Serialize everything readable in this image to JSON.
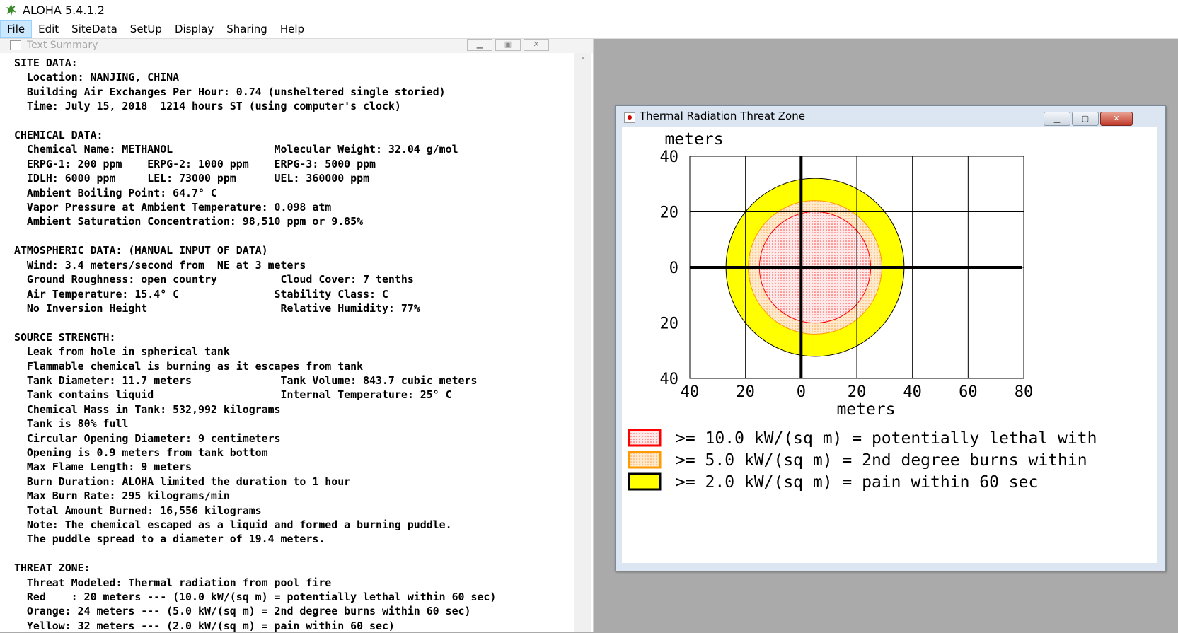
{
  "app": {
    "title": "ALOHA 5.4.1.2"
  },
  "menu": {
    "items": [
      {
        "label": "File",
        "active": true
      },
      {
        "label": "Edit"
      },
      {
        "label": "SiteData"
      },
      {
        "label": "SetUp"
      },
      {
        "label": "Display"
      },
      {
        "label": "Sharing"
      },
      {
        "label": "Help"
      }
    ]
  },
  "summary_window": {
    "title": "Text Summary",
    "lines": [
      "SITE DATA:",
      "  Location: NANJING, CHINA",
      "  Building Air Exchanges Per Hour: 0.74 (unsheltered single storied)",
      "  Time: July 15, 2018  1214 hours ST (using computer's clock)",
      "",
      "CHEMICAL DATA:",
      "  Chemical Name: METHANOL                Molecular Weight: 32.04 g/mol",
      "  ERPG-1: 200 ppm    ERPG-2: 1000 ppm    ERPG-3: 5000 ppm",
      "  IDLH: 6000 ppm     LEL: 73000 ppm      UEL: 360000 ppm",
      "  Ambient Boiling Point: 64.7° C",
      "  Vapor Pressure at Ambient Temperature: 0.098 atm",
      "  Ambient Saturation Concentration: 98,510 ppm or 9.85%",
      "",
      "ATMOSPHERIC DATA: (MANUAL INPUT OF DATA)",
      "  Wind: 3.4 meters/second from  NE at 3 meters",
      "  Ground Roughness: open country          Cloud Cover: 7 tenths",
      "  Air Temperature: 15.4° C               Stability Class: C",
      "  No Inversion Height                     Relative Humidity: 77%",
      "",
      "SOURCE STRENGTH:",
      "  Leak from hole in spherical tank",
      "  Flammable chemical is burning as it escapes from tank",
      "  Tank Diameter: 11.7 meters              Tank Volume: 843.7 cubic meters",
      "  Tank contains liquid                    Internal Temperature: 25° C",
      "  Chemical Mass in Tank: 532,992 kilograms",
      "  Tank is 80% full",
      "  Circular Opening Diameter: 9 centimeters",
      "  Opening is 0.9 meters from tank bottom",
      "  Max Flame Length: 9 meters",
      "  Burn Duration: ALOHA limited the duration to 1 hour",
      "  Max Burn Rate: 295 kilograms/min",
      "  Total Amount Burned: 16,556 kilograms",
      "  Note: The chemical escaped as a liquid and formed a burning puddle.",
      "  The puddle spread to a diameter of 19.4 meters.",
      "",
      "THREAT ZONE:",
      "  Threat Modeled: Thermal radiation from pool fire",
      "  Red    : 20 meters --- (10.0 kW/(sq m) = potentially lethal within 60 sec)",
      "  Orange: 24 meters --- (5.0 kW/(sq m) = 2nd degree burns within 60 sec)",
      "  Yellow: 32 meters --- (2.0 kW/(sq m) = pain within 60 sec)"
    ]
  },
  "threat_window": {
    "title": "Thermal Radiation Threat Zone",
    "y_unit": "meters",
    "x_unit": "meters",
    "y_ticks": [
      "40",
      "20",
      "0",
      "20",
      "40"
    ],
    "x_ticks": [
      "40",
      "20",
      "0",
      "20",
      "40",
      "60",
      "80"
    ],
    "legend": [
      {
        "text": ">= 10.0 kW/(sq m)  = potentially lethal with",
        "border": "#ff0000",
        "fill": "#ffe0e0"
      },
      {
        "text": ">= 5.0 kW/(sq m)  = 2nd degree burns within",
        "border": "#ff9900",
        "fill": "#ffd9a8"
      },
      {
        "text": ">= 2.0 kW/(sq m)  = pain within 60 sec",
        "border": "#000000",
        "fill": "#ffff00"
      }
    ]
  },
  "chart_data": {
    "type": "threat-zone",
    "xlim": [
      -40,
      80
    ],
    "ylim": [
      -40,
      40
    ],
    "xlabel": "meters",
    "ylabel": "meters",
    "grid": true,
    "zones": [
      {
        "name": "Yellow",
        "radius_m": 32,
        "center_x": 5,
        "center_y": 0,
        "color": "#ffff00",
        "edge": "#000000"
      },
      {
        "name": "Orange",
        "radius_m": 24,
        "center_x": 5,
        "center_y": 0,
        "color": "#ffd9a8",
        "edge": "#ff9900"
      },
      {
        "name": "Red",
        "radius_m": 20,
        "center_x": 5,
        "center_y": 0,
        "color": "#ffd6d6",
        "edge": "#ff0000"
      }
    ]
  }
}
